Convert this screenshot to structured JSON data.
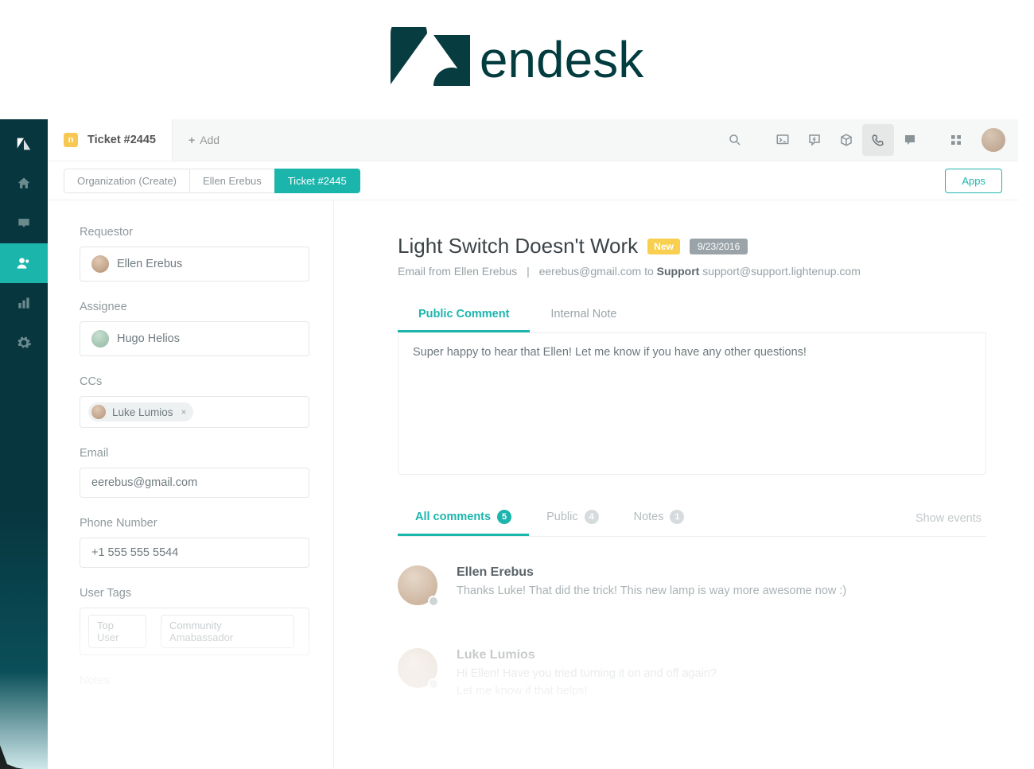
{
  "brand": {
    "name": "endesk"
  },
  "topbar": {
    "ticket_badge": "n",
    "ticket_label": "Ticket #2445",
    "add_label": "Add"
  },
  "crumbs": {
    "items": [
      {
        "label": "Organization (Create)"
      },
      {
        "label": "Ellen Erebus"
      },
      {
        "label": "Ticket #2445"
      }
    ],
    "apps_label": "Apps"
  },
  "sidebar": {
    "requestor_label": "Requestor",
    "requestor_value": "Ellen Erebus",
    "assignee_label": "Assignee",
    "assignee_value": "Hugo Helios",
    "ccs_label": "CCs",
    "ccs_chip": "Luke Lumios",
    "email_label": "Email",
    "email_value": "eerebus@gmail.com",
    "phone_label": "Phone Number",
    "phone_value": "+1 555 555 5544",
    "tags_label": "User Tags",
    "tags": [
      "Top User",
      "Community Amabassador"
    ],
    "notes_label": "Notes"
  },
  "ticket": {
    "title": "Light Switch Doesn't Work",
    "status": "New",
    "date": "9/23/2016",
    "meta_prefix": "Email from Ellen Erebus",
    "meta_from": "eerebus@gmail.com to",
    "meta_support_label": "Support",
    "meta_support_email": "support@support.lightenup.com"
  },
  "comment_tabs": {
    "public": "Public Comment",
    "internal": "Internal Note"
  },
  "comment_box": {
    "value": "Super happy to hear that Ellen! Let me know if you have any other questions!"
  },
  "filters": {
    "all_label": "All comments",
    "all_count": "5",
    "public_label": "Public",
    "public_count": "4",
    "notes_label": "Notes",
    "notes_count": "1",
    "show_events": "Show events"
  },
  "thread": [
    {
      "author": "Ellen Erebus",
      "body": "Thanks Luke! That did the trick! This new lamp is way more awesome now :)"
    },
    {
      "author": "Luke Lumios",
      "body": "Hi Ellen! Have you tried turning it on and off again?\nLet me know if that helps!"
    }
  ]
}
